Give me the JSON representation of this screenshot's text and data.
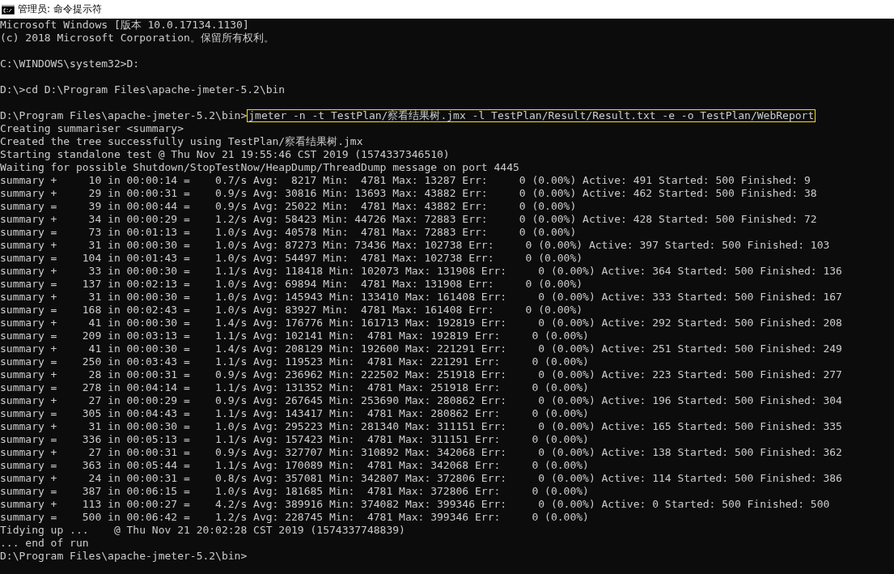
{
  "window": {
    "title": "管理员: 命令提示符"
  },
  "lines": [
    {
      "kind": "output",
      "text": "Microsoft Windows [版本 10.0.17134.1130]"
    },
    {
      "kind": "output",
      "text": "(c) 2018 Microsoft Corporation。保留所有权利。"
    },
    {
      "kind": "blank"
    },
    {
      "kind": "output",
      "text": "C:\\WINDOWS\\system32>D:"
    },
    {
      "kind": "blank"
    },
    {
      "kind": "output",
      "text": "D:\\>cd D:\\Program Files\\apache-jmeter-5.2\\bin"
    },
    {
      "kind": "blank"
    },
    {
      "kind": "command",
      "text": "D:\\Program Files\\apache-jmeter-5.2\\bin>",
      "command": "jmeter -n -t TestPlan/察看结果树.jmx -l TestPlan/Result/Result.txt -e -o TestPlan/WebReport",
      "highlighted": true
    },
    {
      "kind": "output",
      "text": "Creating summariser <summary>"
    },
    {
      "kind": "output",
      "text": "Created the tree successfully using TestPlan/察看结果树.jmx"
    },
    {
      "kind": "output",
      "text": "Starting standalone test @ Thu Nov 21 19:55:46 CST 2019 (1574337346510)"
    },
    {
      "kind": "output",
      "text": "Waiting for possible Shutdown/StopTestNow/HeapDump/ThreadDump message on port 4445"
    },
    {
      "kind": "output",
      "text": "summary +     10 in 00:00:14 =    0.7/s Avg:  8217 Min:  4781 Max: 13287 Err:     0 (0.00%) Active: 491 Started: 500 Finished: 9"
    },
    {
      "kind": "output",
      "text": "summary +     29 in 00:00:31 =    0.9/s Avg: 30816 Min: 13693 Max: 43882 Err:     0 (0.00%) Active: 462 Started: 500 Finished: 38"
    },
    {
      "kind": "output",
      "text": "summary =     39 in 00:00:44 =    0.9/s Avg: 25022 Min:  4781 Max: 43882 Err:     0 (0.00%)"
    },
    {
      "kind": "output",
      "text": "summary +     34 in 00:00:29 =    1.2/s Avg: 58423 Min: 44726 Max: 72883 Err:     0 (0.00%) Active: 428 Started: 500 Finished: 72"
    },
    {
      "kind": "output",
      "text": "summary =     73 in 00:01:13 =    1.0/s Avg: 40578 Min:  4781 Max: 72883 Err:     0 (0.00%)"
    },
    {
      "kind": "output",
      "text": "summary +     31 in 00:00:30 =    1.0/s Avg: 87273 Min: 73436 Max: 102738 Err:     0 (0.00%) Active: 397 Started: 500 Finished: 103"
    },
    {
      "kind": "output",
      "text": "summary =    104 in 00:01:43 =    1.0/s Avg: 54497 Min:  4781 Max: 102738 Err:     0 (0.00%)"
    },
    {
      "kind": "output",
      "text": "summary +     33 in 00:00:30 =    1.1/s Avg: 118418 Min: 102073 Max: 131908 Err:     0 (0.00%) Active: 364 Started: 500 Finished: 136"
    },
    {
      "kind": "output",
      "text": "summary =    137 in 00:02:13 =    1.0/s Avg: 69894 Min:  4781 Max: 131908 Err:     0 (0.00%)"
    },
    {
      "kind": "output",
      "text": "summary +     31 in 00:00:30 =    1.0/s Avg: 145943 Min: 133410 Max: 161408 Err:     0 (0.00%) Active: 333 Started: 500 Finished: 167"
    },
    {
      "kind": "output",
      "text": "summary =    168 in 00:02:43 =    1.0/s Avg: 83927 Min:  4781 Max: 161408 Err:     0 (0.00%)"
    },
    {
      "kind": "output",
      "text": "summary +     41 in 00:00:30 =    1.4/s Avg: 176776 Min: 161713 Max: 192819 Err:     0 (0.00%) Active: 292 Started: 500 Finished: 208"
    },
    {
      "kind": "output",
      "text": "summary =    209 in 00:03:13 =    1.1/s Avg: 102141 Min:  4781 Max: 192819 Err:     0 (0.00%)"
    },
    {
      "kind": "output",
      "text": "summary +     41 in 00:00:30 =    1.4/s Avg: 208129 Min: 192600 Max: 221291 Err:     0 (0.00%) Active: 251 Started: 500 Finished: 249"
    },
    {
      "kind": "output",
      "text": "summary =    250 in 00:03:43 =    1.1/s Avg: 119523 Min:  4781 Max: 221291 Err:     0 (0.00%)"
    },
    {
      "kind": "output",
      "text": "summary +     28 in 00:00:31 =    0.9/s Avg: 236962 Min: 222502 Max: 251918 Err:     0 (0.00%) Active: 223 Started: 500 Finished: 277"
    },
    {
      "kind": "output",
      "text": "summary =    278 in 00:04:14 =    1.1/s Avg: 131352 Min:  4781 Max: 251918 Err:     0 (0.00%)"
    },
    {
      "kind": "output",
      "text": "summary +     27 in 00:00:29 =    0.9/s Avg: 267645 Min: 253690 Max: 280862 Err:     0 (0.00%) Active: 196 Started: 500 Finished: 304"
    },
    {
      "kind": "output",
      "text": "summary =    305 in 00:04:43 =    1.1/s Avg: 143417 Min:  4781 Max: 280862 Err:     0 (0.00%)"
    },
    {
      "kind": "output",
      "text": "summary +     31 in 00:00:30 =    1.0/s Avg: 295223 Min: 281340 Max: 311151 Err:     0 (0.00%) Active: 165 Started: 500 Finished: 335"
    },
    {
      "kind": "output",
      "text": "summary =    336 in 00:05:13 =    1.1/s Avg: 157423 Min:  4781 Max: 311151 Err:     0 (0.00%)"
    },
    {
      "kind": "output",
      "text": "summary +     27 in 00:00:31 =    0.9/s Avg: 327707 Min: 310892 Max: 342068 Err:     0 (0.00%) Active: 138 Started: 500 Finished: 362"
    },
    {
      "kind": "output",
      "text": "summary =    363 in 00:05:44 =    1.1/s Avg: 170089 Min:  4781 Max: 342068 Err:     0 (0.00%)"
    },
    {
      "kind": "output",
      "text": "summary +     24 in 00:00:31 =    0.8/s Avg: 357081 Min: 342807 Max: 372806 Err:     0 (0.00%) Active: 114 Started: 500 Finished: 386"
    },
    {
      "kind": "output",
      "text": "summary =    387 in 00:06:15 =    1.0/s Avg: 181685 Min:  4781 Max: 372806 Err:     0 (0.00%)"
    },
    {
      "kind": "output",
      "text": "summary +    113 in 00:00:27 =    4.2/s Avg: 389916 Min: 374082 Max: 399346 Err:     0 (0.00%) Active: 0 Started: 500 Finished: 500"
    },
    {
      "kind": "output",
      "text": "summary =    500 in 00:06:42 =    1.2/s Avg: 228745 Min:  4781 Max: 399346 Err:     0 (0.00%)"
    },
    {
      "kind": "output",
      "text": "Tidying up ...    @ Thu Nov 21 20:02:28 CST 2019 (1574337748839)"
    },
    {
      "kind": "output",
      "text": "... end of run"
    },
    {
      "kind": "output",
      "text": "D:\\Program Files\\apache-jmeter-5.2\\bin>"
    }
  ]
}
